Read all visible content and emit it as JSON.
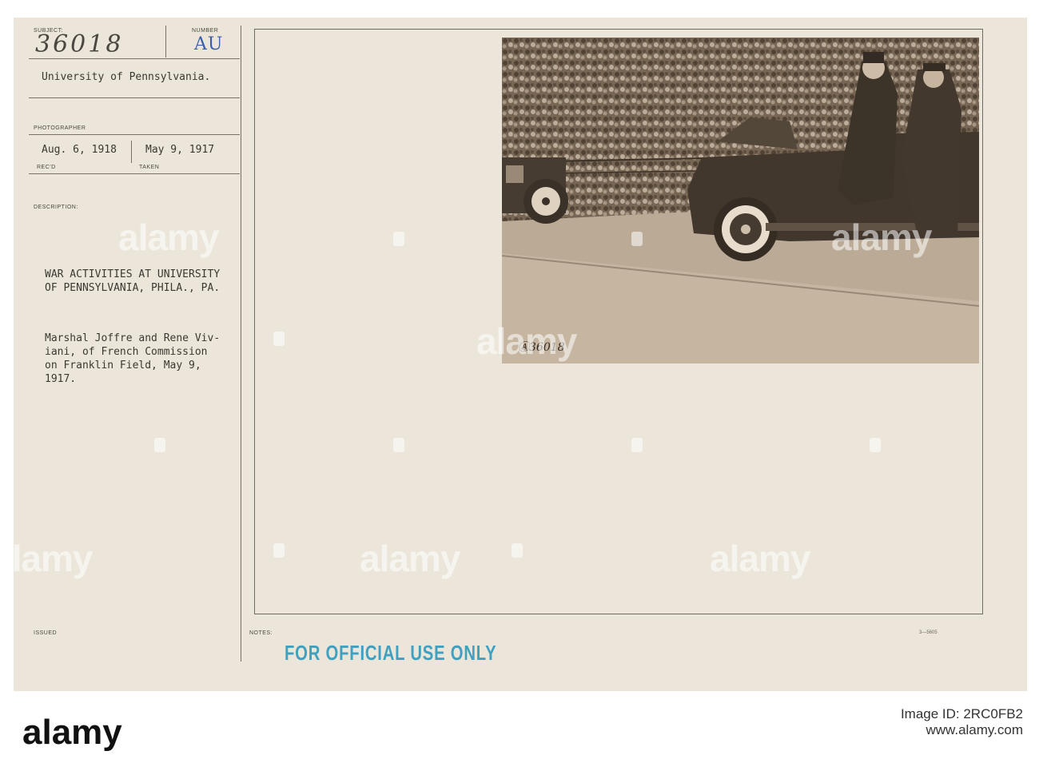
{
  "card": {
    "labels": {
      "subject": "SUBJECT:",
      "number": "NUMBER",
      "photographer": "PHOTOGRAPHER",
      "recd": "REC'D",
      "taken": "TAKEN",
      "description": "DESCRIPTION:",
      "issued": "ISSUED",
      "notes": "NOTES:"
    },
    "subject_number": "36018",
    "number_stamp": "AU",
    "subject_text": "University of Pennsylvania.",
    "recd_date": "Aug. 6, 1918",
    "taken_date": "May 9, 1917",
    "description_title": "WAR ACTIVITIES AT UNIVERSITY\nOF PENNSYLVANIA, PHILA., PA.",
    "description_body": "Marshal Joffre and Rene Viv-\niani, of French Commission\non Franklin Field, May 9,\n1917.",
    "photo_number": "Ⓐ36018",
    "official_stamp": "FOR OFFICIAL USE ONLY",
    "form_number": "3—5605"
  },
  "watermark": {
    "text": "alamy"
  },
  "footer": {
    "brand": "alamy",
    "image_id_label": "Image ID: 2RC0FB2",
    "site": "www.alamy.com"
  },
  "colors": {
    "card": "#ece6da",
    "ink": "#3b3832",
    "stamp_blue": "#3fa0c0",
    "au_blue": "#3a5ea8"
  }
}
